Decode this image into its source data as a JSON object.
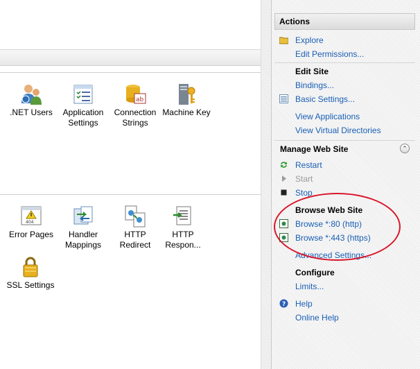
{
  "features": {
    "row1": [
      {
        "key": "net-users",
        "label": ".NET Users"
      },
      {
        "key": "application-settings",
        "label": "Application\nSettings"
      },
      {
        "key": "connection-strings",
        "label": "Connection\nStrings"
      },
      {
        "key": "machine-key",
        "label": "Machine Key"
      }
    ],
    "row2": [
      {
        "key": "error-pages",
        "label": "Error Pages"
      },
      {
        "key": "handler-mappings",
        "label": "Handler\nMappings"
      },
      {
        "key": "http-redirect",
        "label": "HTTP\nRedirect"
      },
      {
        "key": "http-response",
        "label": "HTTP\nRespon..."
      }
    ],
    "row3": [
      {
        "key": "ssl-settings",
        "label": "SSL Settings"
      }
    ]
  },
  "actions": {
    "title": "Actions",
    "explore": "Explore",
    "edit_permissions": "Edit Permissions...",
    "edit_site_header": "Edit Site",
    "bindings": "Bindings...",
    "basic_settings": "Basic Settings...",
    "view_applications": "View Applications",
    "view_virtual_directories": "View Virtual Directories",
    "manage_header": "Manage Web Site",
    "collapse_glyph": "⌃",
    "restart": "Restart",
    "start": "Start",
    "stop": "Stop",
    "browse_header": "Browse Web Site",
    "browse_http": "Browse *:80 (http)",
    "browse_https": "Browse *:443 (https)",
    "advanced_settings": "Advanced Settings...",
    "configure_header": "Configure",
    "limits": "Limits...",
    "help": "Help",
    "online_help": "Online Help"
  },
  "colors": {
    "link": "#1a5fb4",
    "highlight_ellipse": "#d9162a"
  }
}
